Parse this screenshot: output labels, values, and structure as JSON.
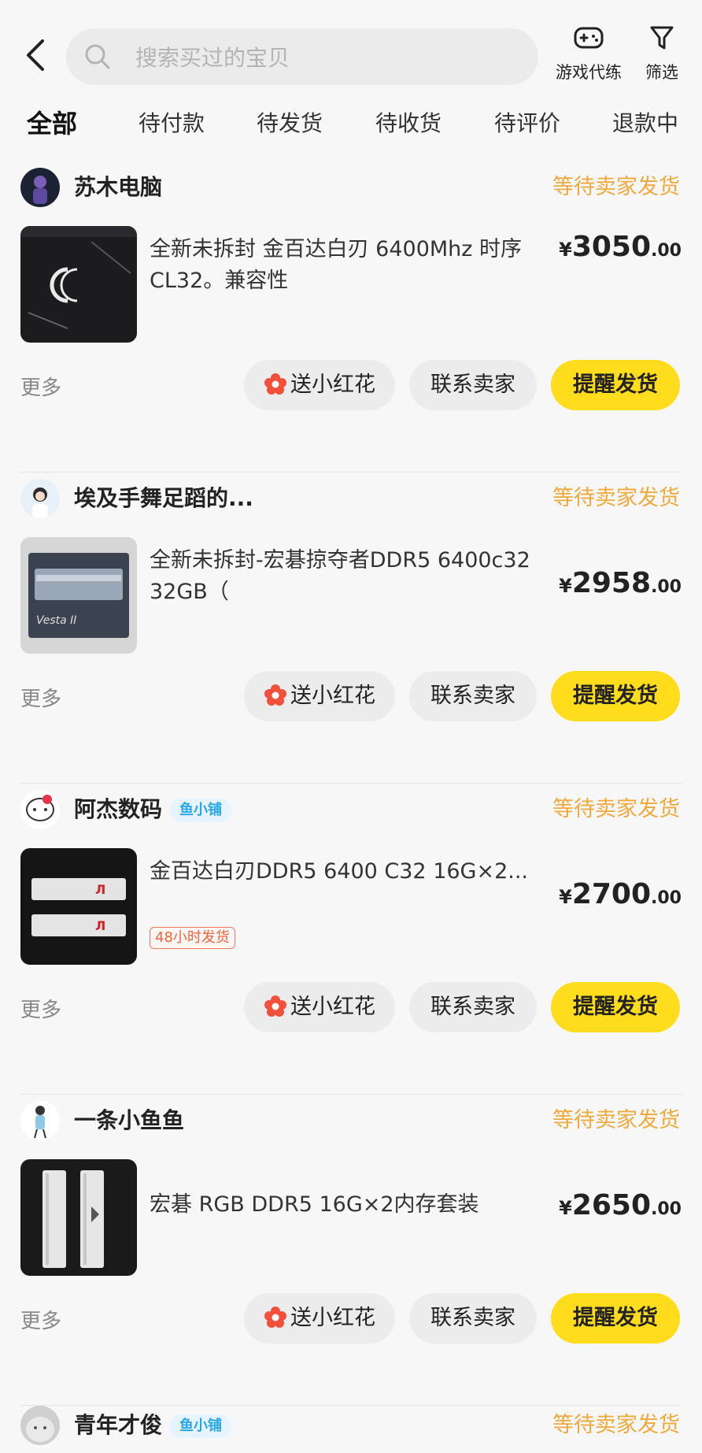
{
  "header": {
    "search_placeholder": "搜索买过的宝贝",
    "actions": [
      {
        "label": "游戏代练",
        "icon": "gamepad-icon"
      },
      {
        "label": "筛选",
        "icon": "filter-icon"
      }
    ]
  },
  "tabs": [
    {
      "label": "全部",
      "active": true
    },
    {
      "label": "待付款",
      "active": false
    },
    {
      "label": "待发货",
      "active": false
    },
    {
      "label": "待收货",
      "active": false
    },
    {
      "label": "待评价",
      "active": false
    },
    {
      "label": "退款中",
      "active": false
    }
  ],
  "orders": [
    {
      "shop_name": "苏木电脑",
      "shop_badge": "",
      "status": "等待卖家发货",
      "title": "全新未拆封 金百达白刃 6400Mhz 时序CL32。兼容性",
      "tag": "",
      "price_currency": "¥",
      "price_int": "3050",
      "price_dec": ".00",
      "more": "更多",
      "btn_flower": "送小红花",
      "btn_contact": "联系卖家",
      "btn_remind": "提醒发货"
    },
    {
      "shop_name": "埃及手舞足蹈的...",
      "shop_badge": "",
      "status": "等待卖家发货",
      "title": "全新未拆封-宏碁掠夺者DDR5 6400c32 32GB（",
      "tag": "",
      "price_currency": "¥",
      "price_int": "2958",
      "price_dec": ".00",
      "more": "更多",
      "btn_flower": "送小红花",
      "btn_contact": "联系卖家",
      "btn_remind": "提醒发货"
    },
    {
      "shop_name": "阿杰数码",
      "shop_badge": "鱼小铺",
      "status": "等待卖家发货",
      "title": "金百达白刃DDR5 6400 C32 16G×2...",
      "tag": "48小时发货",
      "price_currency": "¥",
      "price_int": "2700",
      "price_dec": ".00",
      "more": "更多",
      "btn_flower": "送小红花",
      "btn_contact": "联系卖家",
      "btn_remind": "提醒发货"
    },
    {
      "shop_name": "一条小鱼鱼",
      "shop_badge": "",
      "status": "等待卖家发货",
      "title": "宏碁 RGB DDR5 16G×2内存套装",
      "tag": "",
      "price_currency": "¥",
      "price_int": "2650",
      "price_dec": ".00",
      "more": "更多",
      "btn_flower": "送小红花",
      "btn_contact": "联系卖家",
      "btn_remind": "提醒发货"
    }
  ],
  "partial_order": {
    "shop_name": "青年才俊",
    "shop_badge": "鱼小铺",
    "status": "等待卖家发货"
  },
  "colors": {
    "accent_yellow": "#ffdc1c",
    "status_orange": "#f0a93c",
    "badge_blue": "#2aa7e8",
    "tag_red": "#f2643f"
  }
}
